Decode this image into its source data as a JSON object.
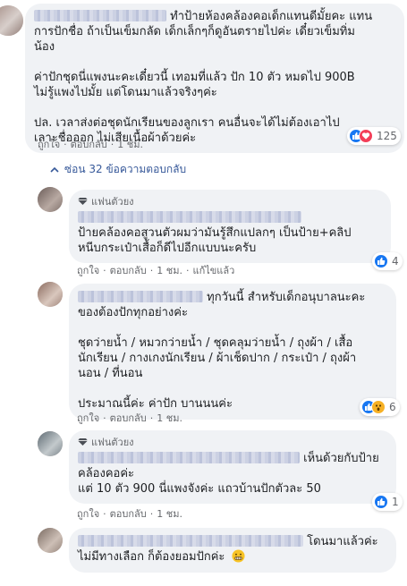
{
  "labels": {
    "like": "ถูกใจ",
    "reply": "ตอบกลับ",
    "edited": "แก้ไขแล้ว",
    "dot": "·",
    "fan": "แฟนตัวยง"
  },
  "comment1": {
    "name_suffix": "ทำป้ายห้องคล้องคอเด็กแทนดีมั้ยคะ แทน",
    "lines": [
      "การปักชื่อ ถ้าเป็นเข็มกลัด เด็กเล็กๆก็ดูอันตรายไปค่ะ เดี๋ยวเข็มทิ่ม",
      "น้อง"
    ],
    "para2": [
      "ค่าปักชุดนี่แพงนะคะเดี๋ยวนี้ เทอมที่แล้ว ปัก 10 ตัว หมดไป 900B",
      "ไม่รู้แพงไปมั้ย แต่โดนมาแล้วจริงๆค่ะ"
    ],
    "para3": [
      "ปล. เวลาส่งต่อชุดนักเรียนของลูกเรา คนอื่นจะได้ไม่ต้องเอาไป",
      "เลาะชื่อออก ไม่เสียเนื้อผ้าด้วยค่ะ"
    ],
    "time": "1 ชม.",
    "reaction_count": "125"
  },
  "hide_replies": "ซ่อน 32 ข้อความตอบกลับ",
  "reply1": {
    "lines": [
      "ป้ายคล้องคอสูวนตัวผมว่ามันรู้สึกแปลกๆ เป็นป้าย+คลิป",
      "หนีบกระเป๋าเสื้อก็ดีไปอีกแบบนะครับ"
    ],
    "time": "1 ชม.",
    "reaction_count": "4"
  },
  "reply2": {
    "name_suffix": "ทุกวันนี้ สำหรับเด็กอนุบาลนะคะ",
    "line1": "ของต้องปักทุกอย่างค่ะ",
    "para2": [
      "ชุดว่ายน้ำ / หมวกว่ายน้ำ / ชุดคลุมว่ายน้ำ / ถุงผ้า / เสื้อ",
      "นักเรียน / กางเกงนักเรียน / ผ้าเช็ดปาก / กระเป๋า / ถุงผ้า",
      "นอน / ที่นอน"
    ],
    "para3": "ประมาณนี้ค่ะ ค่าปัก บานนนค่ะ",
    "time": "1 ชม.",
    "reaction_count": "6"
  },
  "reply3": {
    "name_suffix": "เห็นด้วยกับป้าย",
    "line1": "คล้องคอค่ะ",
    "line2": "แต่ 10 ตัว 900 นี่แพงจังค่ะ แถวบ้านปักตัวละ 50",
    "time": "1 ชม.",
    "reaction_count": "1"
  },
  "reply4": {
    "name_suffix": "โดนมาแล้วค่ะ",
    "line1": "ไม่มีทางเลือก ก็ต้องยอมปักค่ะ"
  },
  "colors": {
    "like_blue": "#1877f2",
    "love_red": "#f33e58",
    "wow_yellow": "#f7b125",
    "link": "#365899",
    "bubble": "#f0f2f5"
  },
  "icons": [
    "like-icon",
    "love-icon",
    "wow-icon",
    "diamond-icon",
    "reply-arrow-icon",
    "grimace-emoji-icon"
  ]
}
